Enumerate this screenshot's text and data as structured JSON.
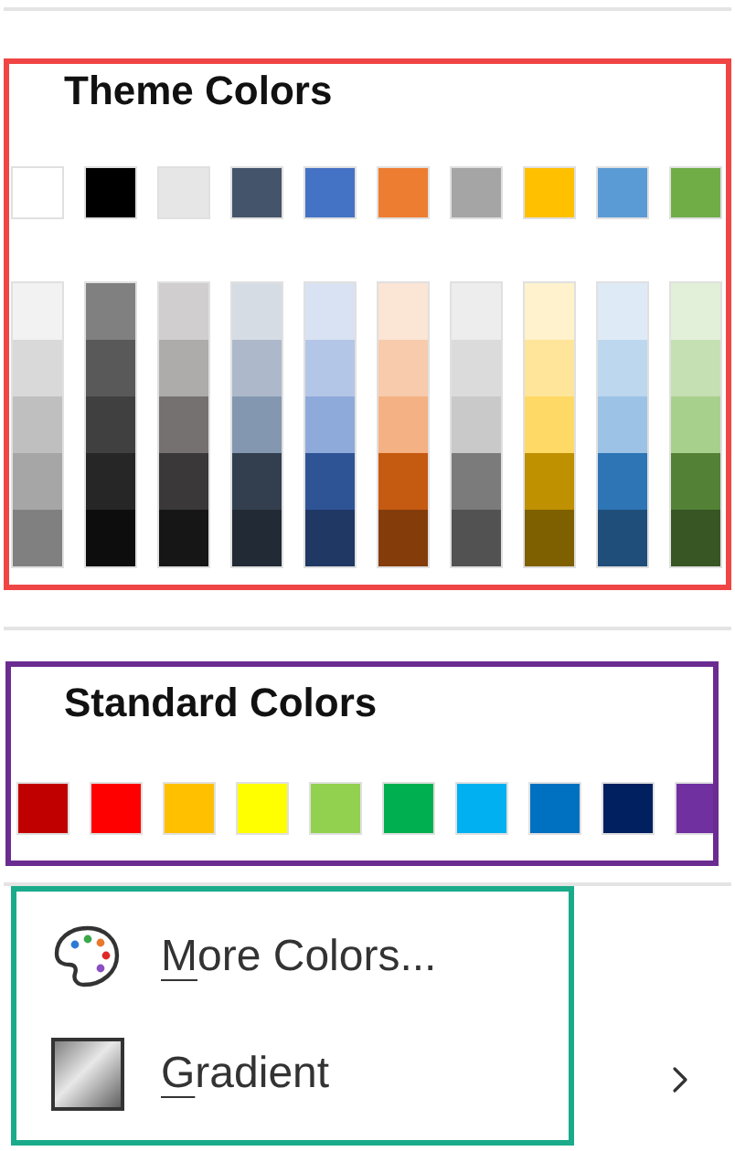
{
  "theme_colors": {
    "title": "Theme Colors",
    "color": "#f04545",
    "columns": [
      {
        "color": "#ffffff",
        "shades": [
          {
            "color": "#f2f2f2"
          },
          {
            "color": "#d9d9d9"
          },
          {
            "color": "#bfbfbf"
          },
          {
            "color": "#a6a6a6"
          },
          {
            "color": "#808080"
          }
        ]
      },
      {
        "color": "#000000",
        "shades": [
          {
            "color": "#808080"
          },
          {
            "color": "#595959"
          },
          {
            "color": "#404040"
          },
          {
            "color": "#262626"
          },
          {
            "color": "#0d0d0d"
          }
        ]
      },
      {
        "color": "#e7e6e6",
        "shades": [
          {
            "color": "#d0cece"
          },
          {
            "color": "#aeabab"
          },
          {
            "color": "#757171"
          },
          {
            "color": "#3a3838"
          },
          {
            "color": "#171616"
          }
        ]
      },
      {
        "color": "#44546a",
        "shades": [
          {
            "color": "#d6dce4"
          },
          {
            "color": "#adb9ca"
          },
          {
            "color": "#8497b0"
          },
          {
            "color": "#333f4f"
          },
          {
            "color": "#222a35"
          }
        ]
      },
      {
        "color": "#4472c4",
        "shades": [
          {
            "color": "#d9e2f3"
          },
          {
            "color": "#b4c6e7"
          },
          {
            "color": "#8eaadb"
          },
          {
            "color": "#2f5496"
          },
          {
            "color": "#1f3864"
          }
        ]
      },
      {
        "color": "#ed7d31",
        "shades": [
          {
            "color": "#fbe5d5"
          },
          {
            "color": "#f7cbac"
          },
          {
            "color": "#f4b183"
          },
          {
            "color": "#c55a11"
          },
          {
            "color": "#843c0b"
          }
        ]
      },
      {
        "color": "#a5a5a5",
        "shades": [
          {
            "color": "#ededed"
          },
          {
            "color": "#dbdbdb"
          },
          {
            "color": "#c9c9c9"
          },
          {
            "color": "#7b7b7b"
          },
          {
            "color": "#525252"
          }
        ]
      },
      {
        "color": "#ffc000",
        "shades": [
          {
            "color": "#fff2cc"
          },
          {
            "color": "#fee599"
          },
          {
            "color": "#ffd965"
          },
          {
            "color": "#bf9000"
          },
          {
            "color": "#7f6000"
          }
        ]
      },
      {
        "color": "#5b9bd5",
        "shades": [
          {
            "color": "#deebf6"
          },
          {
            "color": "#bdd7ee"
          },
          {
            "color": "#9cc3e5"
          },
          {
            "color": "#2e75b5"
          },
          {
            "color": "#1e4e79"
          }
        ]
      },
      {
        "color": "#70ad47",
        "shades": [
          {
            "color": "#e2efd9"
          },
          {
            "color": "#c5e0b3"
          },
          {
            "color": "#a8d08d"
          },
          {
            "color": "#538135"
          },
          {
            "color": "#375623"
          }
        ]
      }
    ]
  },
  "standard_colors": {
    "title": "Standard Colors",
    "color": "#6b2c91",
    "swatches": [
      {
        "color": "#c00000"
      },
      {
        "color": "#ff0000"
      },
      {
        "color": "#ffc000"
      },
      {
        "color": "#ffff00"
      },
      {
        "color": "#92d050"
      },
      {
        "color": "#00b050"
      },
      {
        "color": "#00b0f0"
      },
      {
        "color": "#0070c0"
      },
      {
        "color": "#002060"
      },
      {
        "color": "#7030a0"
      }
    ]
  },
  "menu": {
    "color": "#1aab8a",
    "items": [
      {
        "kind": "palette",
        "label": "More Colors...",
        "mnemonic_underlined": true,
        "has_submenu": false
      },
      {
        "kind": "gradient",
        "label": "Gradient",
        "mnemonic_underlined": true,
        "has_submenu": true
      }
    ]
  }
}
